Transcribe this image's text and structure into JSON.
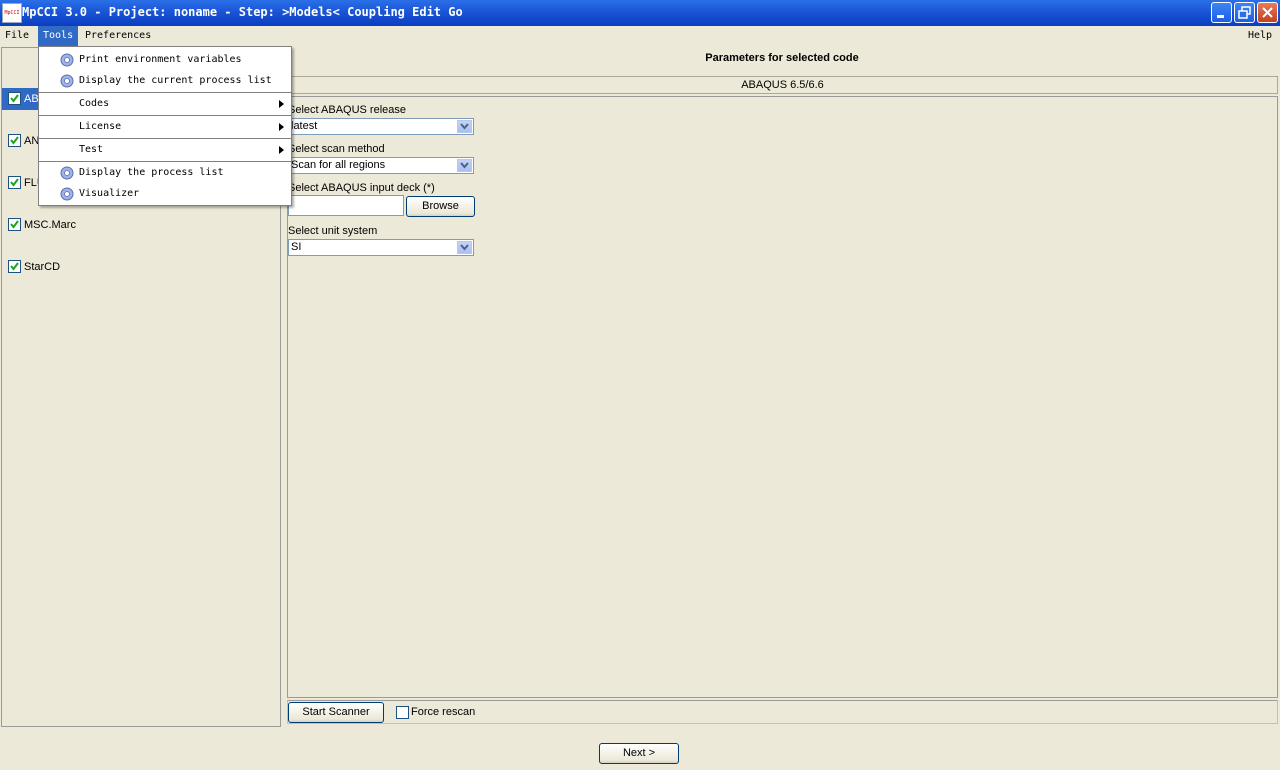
{
  "window": {
    "icon_text": "MpCCI",
    "title": "MpCCI 3.0 - Project: noname - Step: >Models< Coupling Edit Go"
  },
  "menubar": {
    "file": "File",
    "tools": "Tools",
    "preferences": "Preferences",
    "help": "Help"
  },
  "tools_menu": {
    "items": [
      {
        "label": "Print environment variables",
        "icon": "gear-icon"
      },
      {
        "label": "Display the current process list",
        "icon": "gear-icon"
      },
      {
        "label": "Codes",
        "submenu": true
      },
      {
        "label": "License",
        "submenu": true
      },
      {
        "label": "Test",
        "submenu": true
      },
      {
        "label": "Display the process list",
        "icon": "gear-icon"
      },
      {
        "label": "Visualizer",
        "icon": "gear-icon"
      }
    ]
  },
  "codes_list": [
    {
      "label": "AB",
      "checked": true,
      "selected": true
    },
    {
      "label": "AN",
      "checked": true,
      "selected": false
    },
    {
      "label": "FLU",
      "checked": true,
      "selected": false
    },
    {
      "label": "MSC.Marc",
      "checked": true,
      "selected": false
    },
    {
      "label": "StarCD",
      "checked": true,
      "selected": false
    }
  ],
  "params": {
    "title": "Parameters for selected code",
    "code_name": "ABAQUS 6.5/6.6",
    "release_label": "Select ABAQUS release",
    "release_value": "latest",
    "scan_label": "Select scan method",
    "scan_value": "Scan for all regions",
    "deck_label": "Select ABAQUS input deck (*)",
    "deck_value": "",
    "browse_label": "Browse",
    "unit_label": "Select unit system",
    "unit_value": "SI"
  },
  "bottom": {
    "start_scanner": "Start Scanner",
    "force_rescan": "Force rescan",
    "force_rescan_checked": false,
    "next": "Next >"
  }
}
